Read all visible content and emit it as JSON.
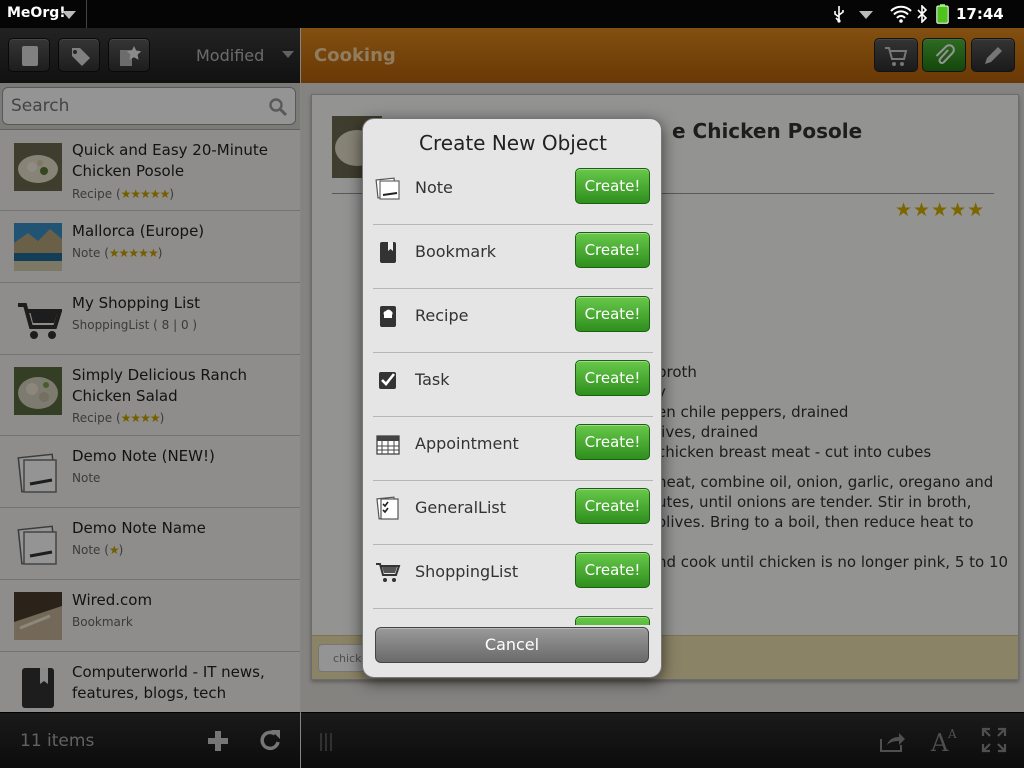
{
  "status": {
    "app_name": "MeOrg!",
    "time": "17:44"
  },
  "left": {
    "sort_label": "Modified",
    "search": {
      "placeholder": "Search",
      "value": ""
    },
    "items": [
      {
        "title": "Quick and Easy 20-Minute Chicken Posole",
        "type": "Recipe",
        "stars": "★★★★★"
      },
      {
        "title": "Mallorca (Europe)",
        "type": "Note",
        "stars": "★★★★★"
      },
      {
        "title": "My Shopping List",
        "type": "ShoppingList ( 8 | 0 )",
        "stars": ""
      },
      {
        "title": "Simply Delicious Ranch Chicken Salad",
        "type": "Recipe",
        "stars": "★★★★"
      },
      {
        "title": "Demo Note (NEW!)",
        "type": "Note",
        "stars": ""
      },
      {
        "title": "Demo Note Name",
        "type": "Note",
        "stars": "★"
      },
      {
        "title": "Wired.com",
        "type": "Bookmark",
        "stars": ""
      },
      {
        "title": "Computerworld - IT news, features, blogs, tech",
        "type": "",
        "stars": ""
      }
    ],
    "count": "11 items"
  },
  "right": {
    "category": "Cooking",
    "title_fragment": "e Chicken Posole",
    "stars": "★★★★★",
    "ingredients": [
      "broth",
      "y",
      "en chile peppers, drained",
      "lives, drained",
      "chicken breast meat - cut into cubes"
    ],
    "directions": [
      "heat, combine oil, onion, garlic, oregano and",
      "utes, until onions are tender. Stir in broth,",
      "olives. Bring to a boil, then reduce heat to",
      "nd cook until chicken is no longer pink, 5 to 10"
    ],
    "tag": "chicke"
  },
  "dialog": {
    "title": "Create New Object",
    "create_label": "Create!",
    "cancel_label": "Cancel",
    "options": [
      {
        "label": "Note",
        "icon": "note-icon"
      },
      {
        "label": "Bookmark",
        "icon": "bookmark-icon"
      },
      {
        "label": "Recipe",
        "icon": "recipe-icon"
      },
      {
        "label": "Task",
        "icon": "task-icon"
      },
      {
        "label": "Appointment",
        "icon": "calendar-icon"
      },
      {
        "label": "GeneralList",
        "icon": "checklist-icon"
      },
      {
        "label": "ShoppingList",
        "icon": "cart-icon"
      }
    ]
  },
  "colors": {
    "header_orange": "#c8730f",
    "create_green": "#3fa02b",
    "stars_gold": "#d6b000"
  }
}
